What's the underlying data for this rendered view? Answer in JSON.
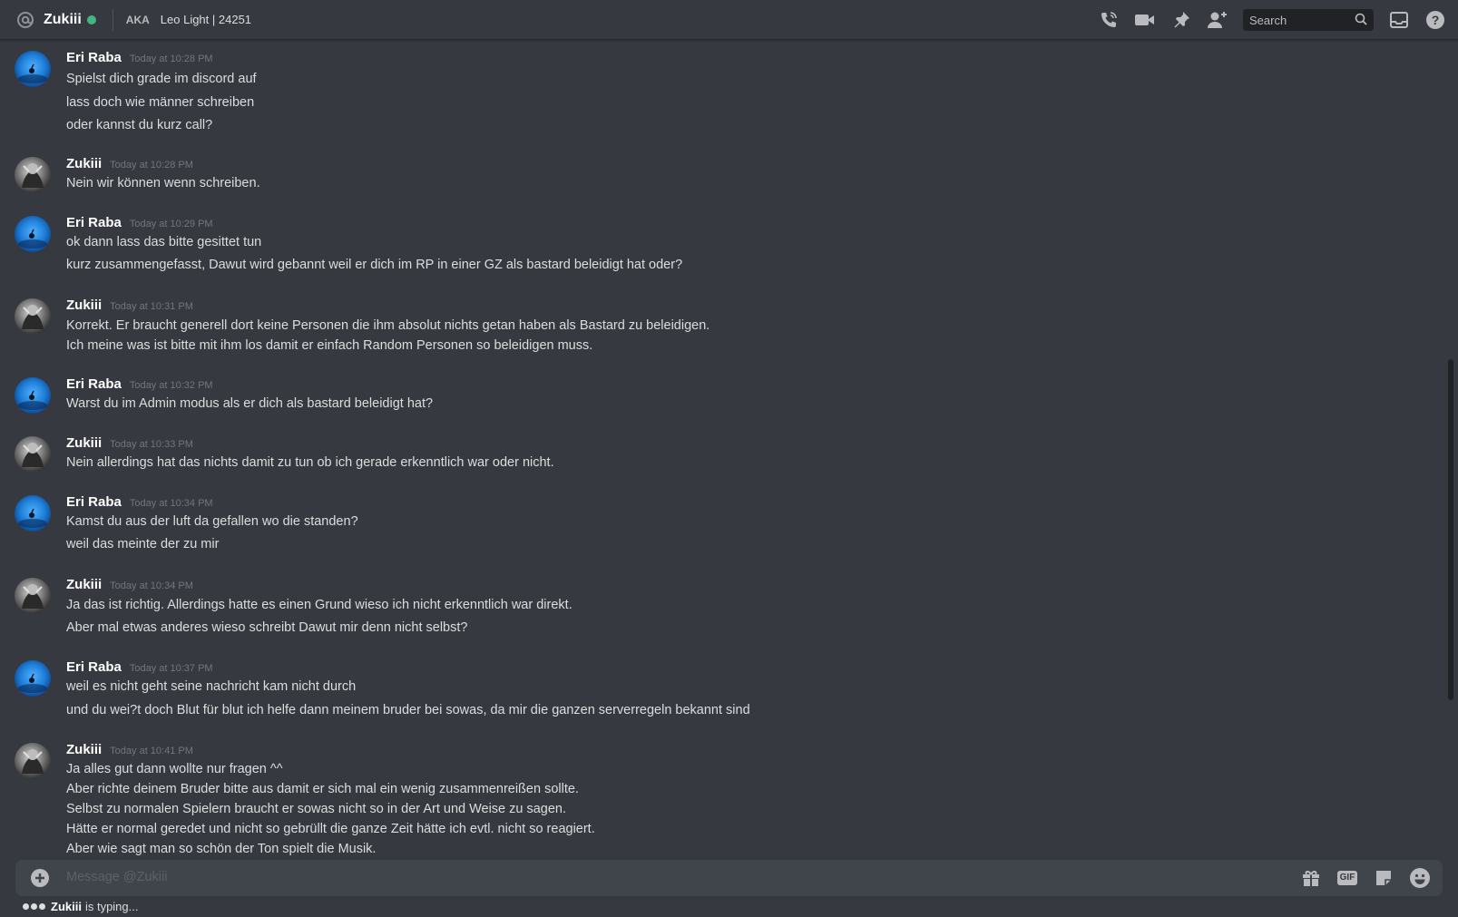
{
  "header": {
    "channel_name": "Zukiii",
    "status": "online",
    "aka_label": "AKA",
    "aka_names": "Leo Light | 24251",
    "search_placeholder": "Search",
    "icons": [
      "at-icon",
      "phone-icon",
      "video-icon",
      "pin-icon",
      "add-friend-icon",
      "search-icon",
      "inbox-icon",
      "help-icon"
    ]
  },
  "messages": [
    {
      "author": "Eri Raba",
      "time": "Today at 10:28 PM",
      "avatar": "eri",
      "lines": [
        "Spielst dich grade im discord auf",
        "lass doch wie männer schreiben",
        "oder kannst du kurz call?"
      ]
    },
    {
      "author": "Zukiii",
      "time": "Today at 10:28 PM",
      "avatar": "zuk",
      "lines": [
        "Nein wir können wenn schreiben."
      ]
    },
    {
      "author": "Eri Raba",
      "time": "Today at 10:29 PM",
      "avatar": "eri",
      "lines": [
        "ok dann lass das bitte gesittet tun",
        "kurz zusammengefasst, Dawut wird gebannt weil er dich im RP in einer GZ als bastard beleidigt hat oder?"
      ]
    },
    {
      "author": "Zukiii",
      "time": "Today at 10:31 PM",
      "avatar": "zuk",
      "lines": [
        "Korrekt. Er braucht generell dort keine Personen die ihm absolut nichts getan haben als Bastard zu beleidigen.",
        "Ich meine was ist bitte mit ihm los damit er einfach Random Personen so beleidigen muss."
      ]
    },
    {
      "author": "Eri Raba",
      "time": "Today at 10:32 PM",
      "avatar": "eri",
      "lines": [
        "Warst du im Admin modus als er dich als bastard beleidigt hat?"
      ]
    },
    {
      "author": "Zukiii",
      "time": "Today at 10:33 PM",
      "avatar": "zuk",
      "lines": [
        "Nein allerdings hat das nichts damit zu tun ob ich gerade erkenntlich war oder nicht."
      ]
    },
    {
      "author": "Eri Raba",
      "time": "Today at 10:34 PM",
      "avatar": "eri",
      "lines": [
        "Kamst du aus der luft da gefallen wo die standen?",
        "weil das meinte der zu mir"
      ]
    },
    {
      "author": "Zukiii",
      "time": "Today at 10:34 PM",
      "avatar": "zuk",
      "lines": [
        "Ja das ist richtig. Allerdings hatte es einen Grund wieso ich nicht erkenntlich war direkt.",
        "Aber mal etwas anderes wieso schreibt Dawut mir denn nicht selbst?"
      ]
    },
    {
      "author": "Eri Raba",
      "time": "Today at 10:37 PM",
      "avatar": "eri",
      "lines": [
        "weil es nicht geht seine nachricht kam nicht durch",
        "und du wei?t doch Blut für blut ich helfe dann meinem bruder bei sowas, da mir die ganzen serverregeln bekannt sind"
      ]
    },
    {
      "author": "Zukiii",
      "time": "Today at 10:41 PM",
      "avatar": "zuk",
      "lines": [
        "Ja alles gut dann wollte nur fragen ^^",
        "Aber richte deinem Bruder bitte aus damit er sich mal ein wenig zusammenreißen sollte.",
        "Selbst zu normalen Spielern braucht er sowas nicht so in der Art und Weise zu sagen.",
        "Hätte er normal geredet und nicht so gebrüllt die ganze Zeit hätte ich evtl. nicht so reagiert.",
        "Aber wie sagt man so schön der Ton spielt die Musik."
      ]
    }
  ],
  "composer": {
    "placeholder": "Message @Zukiii",
    "gif_label": "GIF",
    "icons": [
      "plus-icon",
      "gift-icon",
      "gif-icon",
      "sticker-icon",
      "emoji-icon"
    ]
  },
  "typing": {
    "user": "Zukiii",
    "text": "is typing..."
  },
  "colors": {
    "background": "#36393f",
    "online": "#43b581",
    "input": "#40444b"
  }
}
